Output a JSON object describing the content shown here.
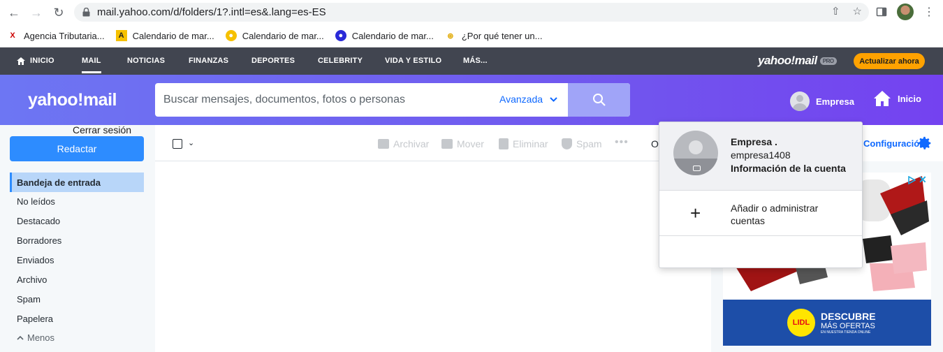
{
  "browser": {
    "url": "mail.yahoo.com/d/folders/1?.intl=es&.lang=es-ES",
    "bookmarks": [
      {
        "label": "Agencia Tributaria...",
        "icon": "tax-agency-icon"
      },
      {
        "label": "Calendario de mar...",
        "icon": "calendar-a-icon"
      },
      {
        "label": "Calendario de mar...",
        "icon": "calendar-yellow-icon"
      },
      {
        "label": "Calendario de mar...",
        "icon": "calendar-blue-icon"
      },
      {
        "label": "¿Por qué tener un...",
        "icon": "medal-icon"
      }
    ]
  },
  "topnav": {
    "items": [
      "INICIO",
      "MAIL",
      "NOTICIAS",
      "FINANZAS",
      "DEPORTES",
      "CELEBRITY",
      "VIDA Y ESTILO",
      "MÁS..."
    ],
    "active": "MAIL",
    "logo": "yahoo!mail",
    "pro": "PRO",
    "upgrade": "Actualizar ahora"
  },
  "header": {
    "logo": "yahoo!mail",
    "search_placeholder": "Buscar mensajes, documentos, fotos o personas",
    "advanced": "Avanzada",
    "account": "Empresa",
    "home": "Inicio"
  },
  "sidebar": {
    "compose": "Redactar",
    "folders": [
      "Bandeja de entrada",
      "No leídos",
      "Destacado",
      "Borradores",
      "Enviados",
      "Archivo",
      "Spam",
      "Papelera"
    ],
    "active": "Bandeja de entrada",
    "less": "Menos"
  },
  "toolbar": {
    "archive": "Archivar",
    "move": "Mover",
    "delete": "Eliminar",
    "spam": "Spam",
    "more": "•••",
    "sort_partial": "O",
    "settings": "Configuración"
  },
  "ad": {
    "line1": "DESCUBRE",
    "line2": "MÁS OFERTAS",
    "line3": "EN NUESTRA TIENDA ONLINE",
    "brand": "LIDL"
  },
  "popover": {
    "name": "Empresa .",
    "username": "empresa1408",
    "account_info": "Información de la cuenta",
    "add_accounts": "Añadir o administrar cuentas",
    "signout": "Cerrar sesión"
  },
  "colors": {
    "accent": "#2d8cff",
    "header_start": "#6d76f3",
    "header_end": "#7442f0",
    "nav_bg": "#414550",
    "upgrade": "#ffa200"
  }
}
